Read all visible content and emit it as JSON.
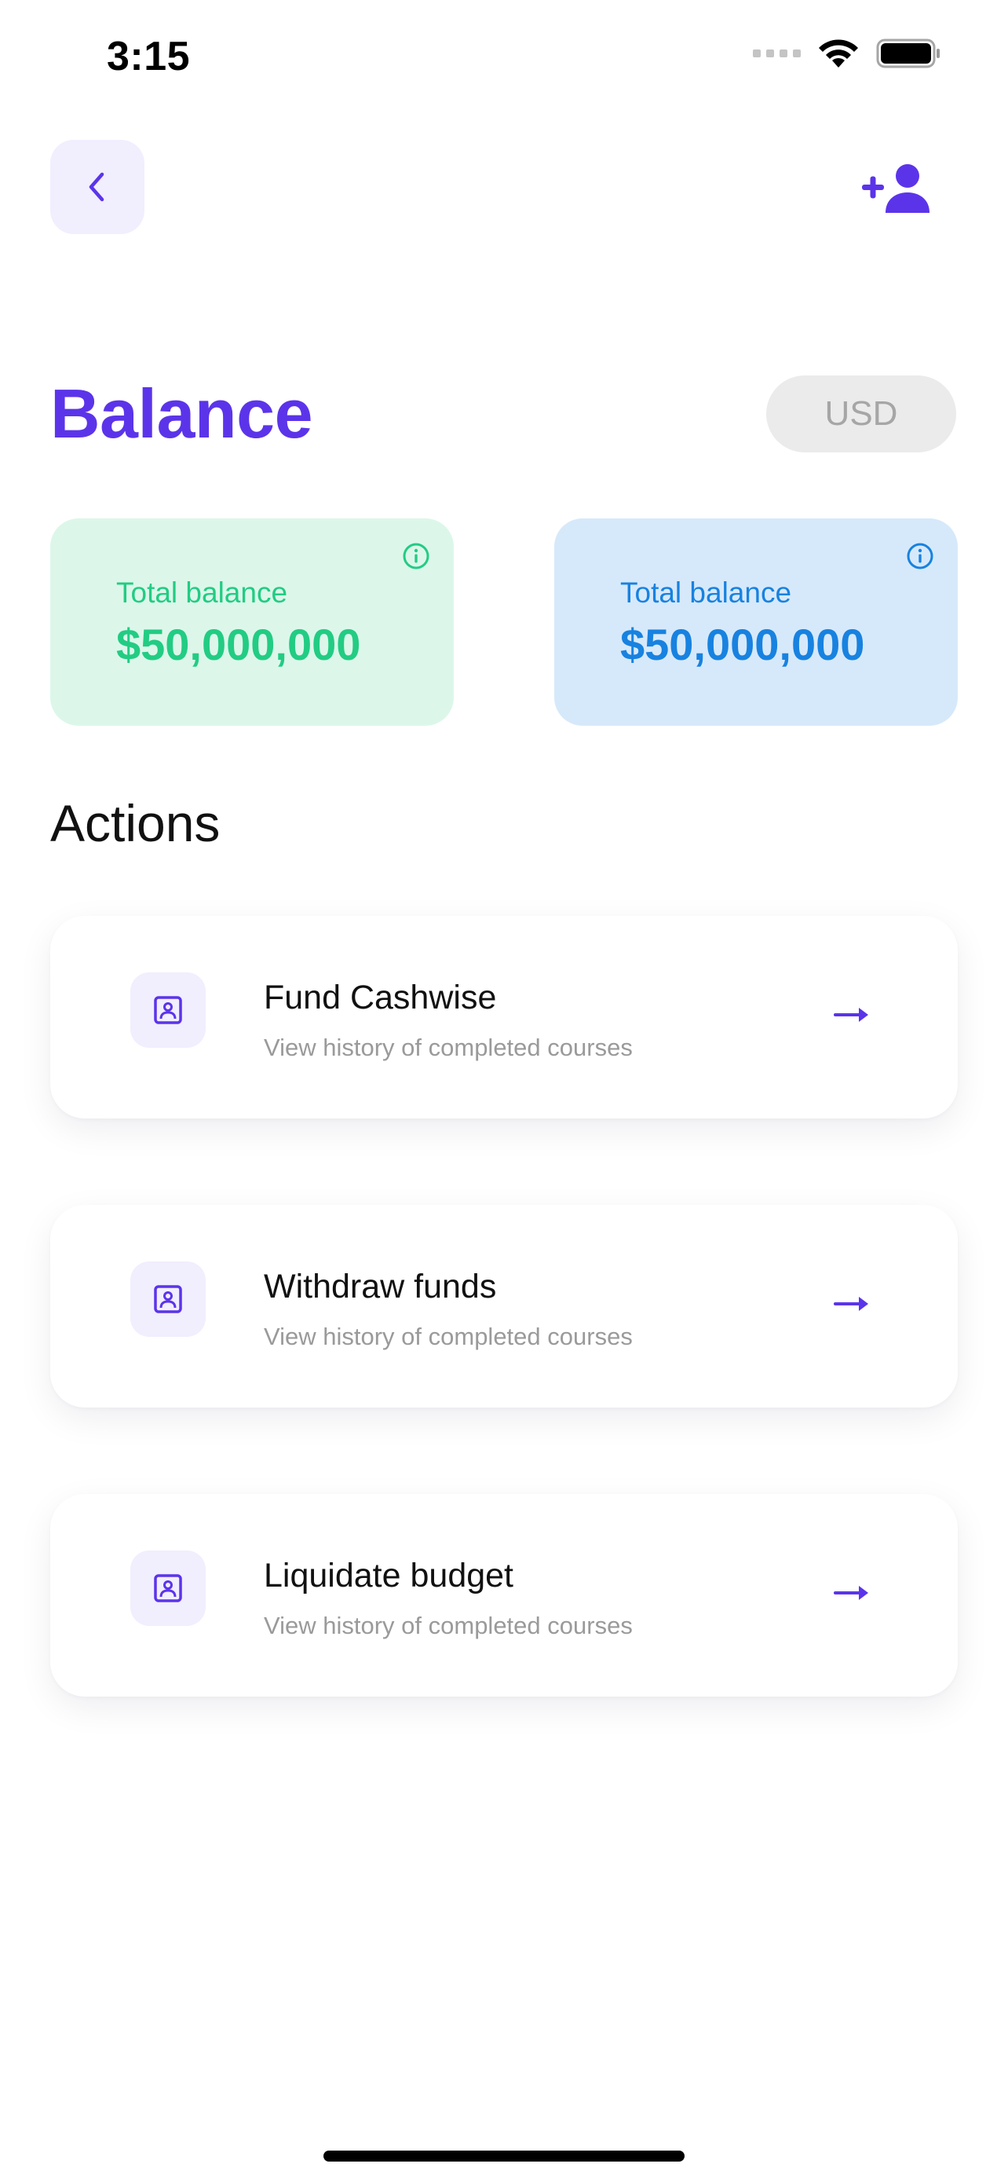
{
  "status_bar": {
    "time": "3:15"
  },
  "header": {
    "back_icon": "chevron-left-icon",
    "add_user_icon": "add-user-icon"
  },
  "balance": {
    "title": "Balance",
    "currency": "USD",
    "cards": [
      {
        "label": "Total balance",
        "value": "$50,000,000",
        "color": "#22CC83",
        "background": "#DCF7EA"
      },
      {
        "label": "Total balance",
        "value": "$50,000,000",
        "color": "#1882E0",
        "background": "#D6E9FA"
      }
    ]
  },
  "actions": {
    "title": "Actions",
    "items": [
      {
        "title": "Fund Cashwise",
        "subtitle": "View history of completed courses",
        "icon": "portrait-icon"
      },
      {
        "title": "Withdraw funds",
        "subtitle": "View history of completed courses",
        "icon": "portrait-icon"
      },
      {
        "title": "Liquidate budget",
        "subtitle": "View history of completed courses",
        "icon": "portrait-icon"
      }
    ]
  },
  "colors": {
    "accent": "#5B34EA",
    "accent_soft": "#F1EEFE",
    "pill_bg": "#EBEBEB",
    "pill_text": "#A6A6A6"
  }
}
